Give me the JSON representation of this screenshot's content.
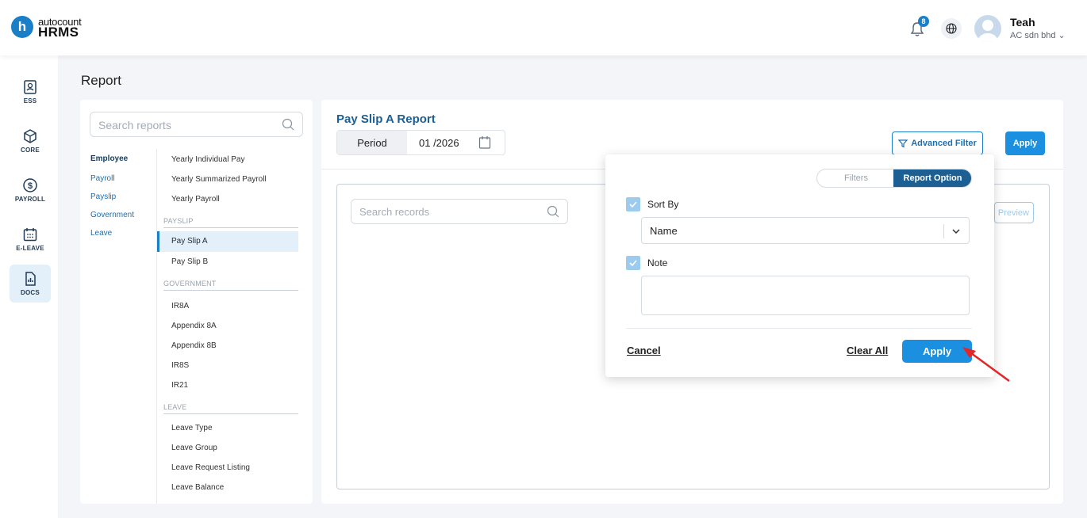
{
  "brand": {
    "logo_letter": "h",
    "logo_top": "autocount",
    "logo_bottom": "HRMS",
    "accent": "#1b7fc7"
  },
  "header": {
    "notification_count": "8",
    "user_name": "Teah",
    "user_org": "AC sdn bhd"
  },
  "nav": [
    {
      "label": "ESS",
      "icon": "ess-icon"
    },
    {
      "label": "CORE",
      "icon": "core-icon"
    },
    {
      "label": "PAYROLL",
      "icon": "payroll-icon"
    },
    {
      "label": "E-LEAVE",
      "icon": "calendar-icon"
    },
    {
      "label": "DOCS",
      "icon": "docs-icon"
    }
  ],
  "page": {
    "title": "Report"
  },
  "reports_panel": {
    "search_placeholder": "Search reports",
    "categories": [
      "Employee",
      "Payroll",
      "Payslip",
      "Government",
      "Leave"
    ],
    "employee_items": [
      "Yearly Individual Pay",
      "Yearly Summarized Payroll",
      "Yearly Payroll"
    ],
    "payslip_section": "PAYSLIP",
    "payslip_items": [
      "Pay Slip A",
      "Pay Slip B"
    ],
    "government_section": "GOVERNMENT",
    "government_items": [
      "IR8A",
      "Appendix 8A",
      "Appendix 8B",
      "IR8S",
      "IR21"
    ],
    "leave_section": "LEAVE",
    "leave_items": [
      "Leave Type",
      "Leave Group",
      "Leave Request Listing",
      "Leave Balance"
    ]
  },
  "report": {
    "title": "Pay Slip A Report",
    "period_label": "Period",
    "period_value": "01 /2026",
    "advanced_filter": "Advanced Filter",
    "apply": "Apply",
    "search_placeholder": "Search records",
    "preview": "Preview"
  },
  "popup": {
    "tab_filters": "Filters",
    "tab_report_option": "Report Option",
    "sort_by_label": "Sort By",
    "sort_by_value": "Name",
    "note_label": "Note",
    "note_value": "",
    "cancel": "Cancel",
    "clear_all": "Clear All",
    "apply": "Apply"
  }
}
